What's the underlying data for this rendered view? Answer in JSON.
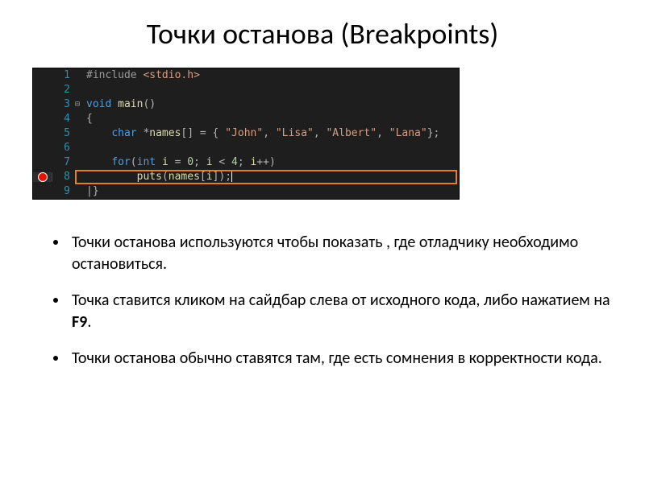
{
  "title": "Точки останова (Breakpoints)",
  "code": {
    "lines": [
      {
        "num": "1",
        "gutter": "",
        "fold": "",
        "tokens": [
          [
            "pp",
            "#include "
          ],
          [
            "inc",
            "<stdio.h>"
          ]
        ]
      },
      {
        "num": "2",
        "gutter": "",
        "fold": "",
        "tokens": []
      },
      {
        "num": "3",
        "gutter": "",
        "fold": "⊟",
        "tokens": [
          [
            "kw",
            "void"
          ],
          [
            "plain",
            " "
          ],
          [
            "id",
            "main"
          ],
          [
            "punct",
            "()"
          ]
        ]
      },
      {
        "num": "4",
        "gutter": "",
        "fold": "",
        "tokens": [
          [
            "punct",
            "{"
          ]
        ]
      },
      {
        "num": "5",
        "gutter": "",
        "fold": "",
        "tokens": [
          [
            "plain",
            "    "
          ],
          [
            "kw",
            "char"
          ],
          [
            "plain",
            " "
          ],
          [
            "punct",
            "*"
          ],
          [
            "id",
            "names"
          ],
          [
            "punct",
            "[] = { "
          ],
          [
            "str",
            "\"John\""
          ],
          [
            "punct",
            ", "
          ],
          [
            "str",
            "\"Lisa\""
          ],
          [
            "punct",
            ", "
          ],
          [
            "str",
            "\"Albert\""
          ],
          [
            "punct",
            ", "
          ],
          [
            "str",
            "\"Lana\""
          ],
          [
            "punct",
            "};"
          ]
        ]
      },
      {
        "num": "6",
        "gutter": "",
        "fold": "",
        "tokens": []
      },
      {
        "num": "7",
        "gutter": "",
        "fold": "",
        "tokens": [
          [
            "plain",
            "    "
          ],
          [
            "kw",
            "for"
          ],
          [
            "punct",
            "("
          ],
          [
            "kw",
            "int"
          ],
          [
            "plain",
            " "
          ],
          [
            "id",
            "i"
          ],
          [
            "plain",
            " "
          ],
          [
            "punct",
            "= "
          ],
          [
            "num",
            "0"
          ],
          [
            "punct",
            "; "
          ],
          [
            "id",
            "i"
          ],
          [
            "plain",
            " "
          ],
          [
            "punct",
            "< "
          ],
          [
            "num",
            "4"
          ],
          [
            "punct",
            "; "
          ],
          [
            "id",
            "i"
          ],
          [
            "punct",
            "++)"
          ]
        ]
      },
      {
        "num": "8",
        "gutter": "bp",
        "fold": "",
        "highlight": true,
        "tokens": [
          [
            "plain",
            "        "
          ],
          [
            "id",
            "puts"
          ],
          [
            "punct",
            "("
          ],
          [
            "id",
            "names"
          ],
          [
            "punct",
            "["
          ],
          [
            "id",
            "i"
          ],
          [
            "punct",
            "]);"
          ]
        ]
      },
      {
        "num": "9",
        "gutter": "",
        "fold": "",
        "tokens": [
          [
            "punct",
            "|}"
          ]
        ]
      }
    ]
  },
  "bullets": [
    {
      "text": "Точки останова используются чтобы показать , где отладчику необходимо остановиться."
    },
    {
      "text_before": "Точка ставится кликом на сайдбар слева от исходного кода, либо нажатием на ",
      "key": "F9",
      "text_after": "."
    },
    {
      "text": "Точки останова обычно ставятся там, где есть сомнения в корректности кода."
    }
  ]
}
